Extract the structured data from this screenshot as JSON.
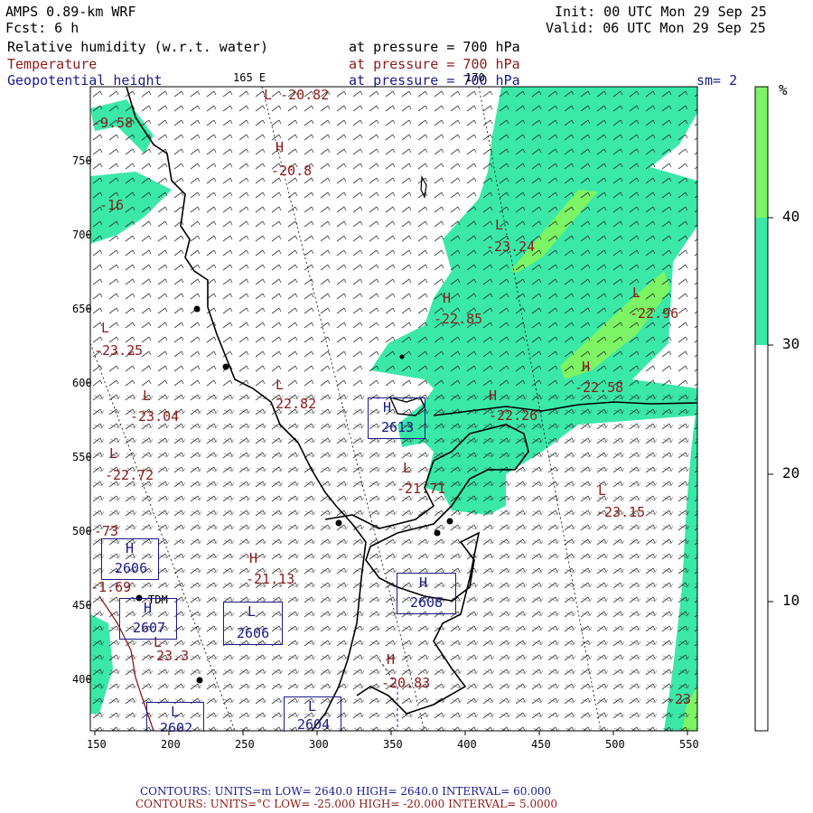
{
  "header": {
    "model": "AMPS 0.89-km WRF",
    "forecast": "Fcst:     6 h",
    "init": "Init: 00 UTC Mon 29 Sep 25",
    "valid": "Valid: 06 UTC Mon 29 Sep 25",
    "fields": [
      {
        "name": "Relative humidity (w.r.t. water)",
        "pressure": "at pressure =  700 hPa",
        "color": "#000000"
      },
      {
        "name": "Temperature",
        "pressure": "at pressure =  700 hPa",
        "color": "#8b1a1a"
      },
      {
        "name": "Geopotential height",
        "pressure": "at pressure = 700 hPa",
        "color": "#1a1a8b"
      }
    ],
    "smoothing": "sm= 2",
    "meridian_label_1": "165 E",
    "meridian_label_2": "170"
  },
  "axes": {
    "x_ticks": [
      "150",
      "200",
      "250",
      "300",
      "350",
      "400",
      "450",
      "500",
      "550"
    ],
    "y_ticks": [
      "750",
      "700",
      "650",
      "600",
      "550",
      "500",
      "450",
      "400"
    ]
  },
  "colorbar": {
    "unit": "%",
    "ticks": [
      "40",
      "30",
      "20",
      "10"
    ],
    "colors": {
      "light": "#7cf464",
      "teal": "#3ae8a8",
      "white": "#ffffff"
    }
  },
  "markers": {
    "temperature": [
      {
        "type": "L",
        "value": "-20.82"
      },
      {
        "type": "H",
        "value": "-20.8"
      },
      {
        "type": "L",
        "value": "-23.24"
      },
      {
        "type": "H",
        "value": "-22.85"
      },
      {
        "type": "L",
        "value": "-22.96"
      },
      {
        "type": "H",
        "value": "-22.58"
      },
      {
        "type": "H",
        "value": "-22.26"
      },
      {
        "type": "L",
        "value": "-23.25"
      },
      {
        "type": "L",
        "value": "-23.04"
      },
      {
        "type": "L",
        "value": "-22.82"
      },
      {
        "type": "L",
        "value": "-22.72"
      },
      {
        "type": "L",
        "value": "-21.71"
      },
      {
        "type": "L",
        "value": "-23.15"
      },
      {
        "type": "H",
        "value": "-21.13"
      },
      {
        "type": "L",
        "value": "-23.3"
      },
      {
        "type": "H",
        "value": "-20.83"
      }
    ],
    "height": [
      {
        "type": "H",
        "value": "2613"
      },
      {
        "type": "H",
        "value": "2606"
      },
      {
        "type": "H",
        "value": "2607"
      },
      {
        "type": "L",
        "value": "2606"
      },
      {
        "type": "H",
        "value": "2608"
      },
      {
        "type": "L",
        "value": "2604"
      },
      {
        "type": "L",
        "value": "2602"
      }
    ],
    "edge_values": [
      "-9.58",
      "-16",
      "-73",
      "-1.69",
      "-23"
    ],
    "station": "TDM"
  },
  "footer": {
    "line1": "CONTOURS:  UNITS=m  LOW=  2640.0       HIGH=  2640.0        INTERVAL=   60.000",
    "line2": "CONTOURS:  UNITS=°C  LOW= -25.000       HIGH= -20.000        INTERVAL=    5.0000"
  }
}
